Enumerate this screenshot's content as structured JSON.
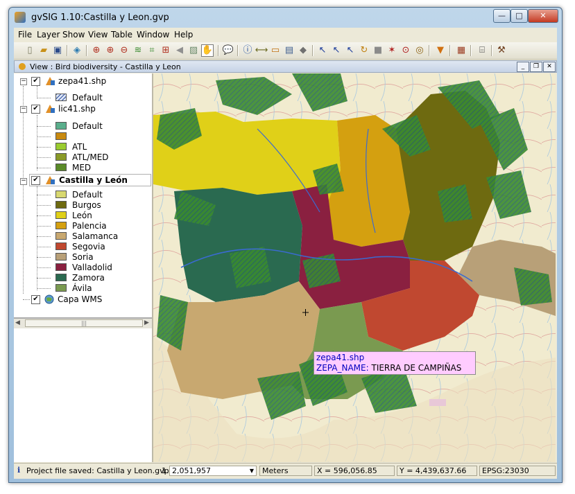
{
  "window": {
    "title": "gvSIG 1.10:Castilla y Leon.gvp",
    "minimize": "—",
    "maximize": "□",
    "close": "✕"
  },
  "menubar": [
    "File",
    "Layer",
    "Show",
    "View",
    "Table",
    "Window",
    "Help"
  ],
  "toolbar_icons": [
    "new-icon",
    "open-icon",
    "save-icon",
    "layer-add-icon",
    "zoom-in-icon",
    "zoom-plus-icon",
    "zoom-minus-icon",
    "layers-icon",
    "zoom-extent-icon",
    "zoom-selection-icon",
    "previous-icon",
    "next-icon",
    "pan-icon",
    "info-bubble-icon",
    "info-icon",
    "measure-distance-icon",
    "measure-area-icon",
    "ruler-icon",
    "graphic-icon",
    "select-icon",
    "select-rect-icon",
    "select-poly-icon",
    "select-rotate-icon",
    "select-shape-icon",
    "select-area-icon",
    "select-circle-icon",
    "target-icon",
    "filter-icon",
    "table-icon",
    "grid-icon",
    "tools-icon"
  ],
  "view": {
    "title": "View : Bird biodiversity - Castilla y Leon"
  },
  "toc": {
    "layers": [
      {
        "name": "zepa41.shp",
        "checked": true,
        "legend": [
          {
            "label": "Default",
            "color": "#c8d8f0",
            "hatched": true
          }
        ]
      },
      {
        "name": "lic41.shp",
        "checked": true,
        "legend": [
          {
            "label": "Default",
            "color": "#5aae8c"
          },
          {
            "label": "",
            "color": "#c88a10"
          },
          {
            "label": "ATL",
            "color": "#9acc30"
          },
          {
            "label": "ATL/MED",
            "color": "#8a9a28"
          },
          {
            "label": "MED",
            "color": "#5a8a28"
          }
        ]
      },
      {
        "name": "Castilla y León",
        "checked": true,
        "bold": true,
        "legend": [
          {
            "label": "Default",
            "color": "#d8d870"
          },
          {
            "label": "Burgos",
            "color": "#6e6a10"
          },
          {
            "label": "León",
            "color": "#e0d018"
          },
          {
            "label": "Palencia",
            "color": "#d4a010"
          },
          {
            "label": "Salamanca",
            "color": "#c8a870"
          },
          {
            "label": "Segovia",
            "color": "#c04830"
          },
          {
            "label": "Soria",
            "color": "#b8a078"
          },
          {
            "label": "Valladolid",
            "color": "#8a2040"
          },
          {
            "label": "Zamora",
            "color": "#2a6a50"
          },
          {
            "label": "Ávila",
            "color": "#7a9a50"
          }
        ]
      },
      {
        "name": "Capa WMS",
        "checked": true,
        "legend": []
      }
    ]
  },
  "tooltip": {
    "layer": "zepa41.shp",
    "field": "ZEPA_NAME:",
    "value": "TIERRA DE CAMPIÑAS"
  },
  "status": {
    "message": "Project file saved: Castilla y Leon.gvp",
    "scale_prefix": "1:",
    "scale": "2,051,957",
    "units": "Meters",
    "x": "X = 596,056.85",
    "y": "Y = 4,439,637.66",
    "epsg": "EPSG:23030"
  },
  "colors": {
    "leon": "#e0d018",
    "palencia": "#d4a010",
    "burgos": "#6e6a10",
    "zamora": "#2a6a50",
    "valladolid": "#8a2040",
    "segovia": "#c04830",
    "soria": "#b8a078",
    "salamanca": "#c8a870",
    "avila": "#7a9a50",
    "zepa": "#2a7a30",
    "basemap": "#f1ebcf"
  }
}
